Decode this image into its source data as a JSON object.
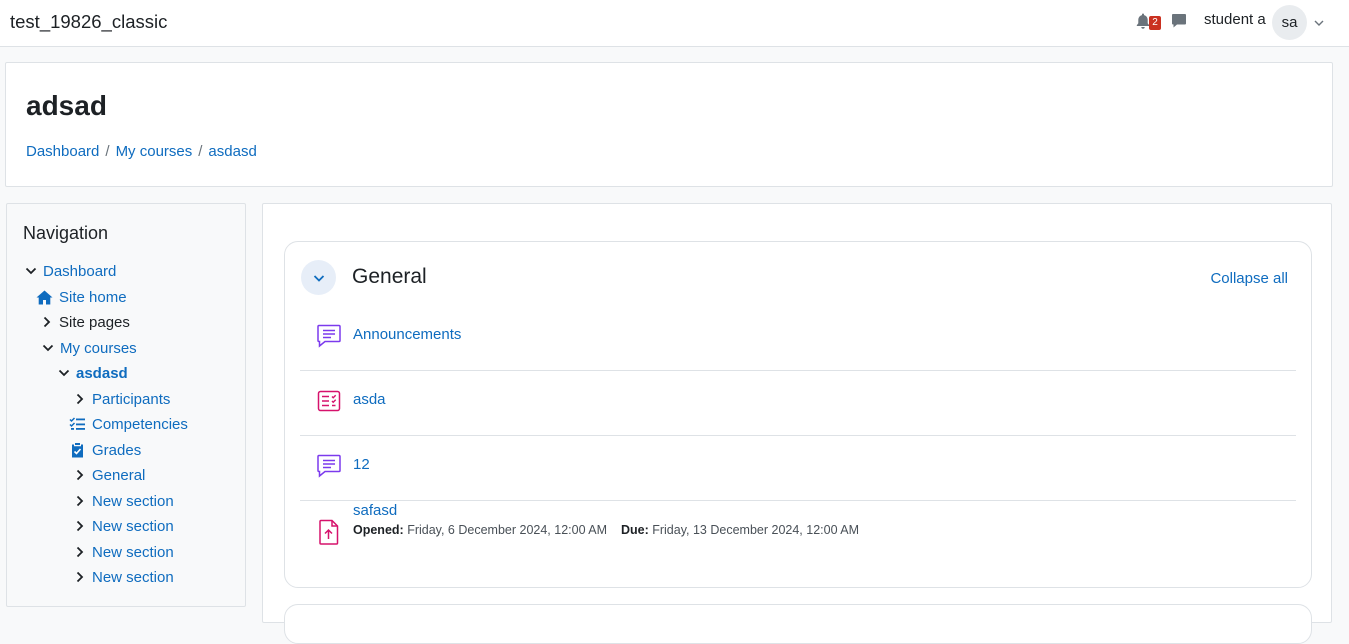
{
  "navbar": {
    "site_name": "test_19826_classic",
    "notifications_count": "2",
    "username": "student a",
    "avatar_initials": "sa"
  },
  "header": {
    "title": "adsad",
    "breadcrumb": [
      "Dashboard",
      "My courses",
      "asdasd"
    ]
  },
  "navigation": {
    "title": "Navigation",
    "items": [
      {
        "label": "Dashboard"
      },
      {
        "label": "Site home"
      },
      {
        "label": "Site pages"
      },
      {
        "label": "My courses"
      },
      {
        "label": "asdasd"
      },
      {
        "label": "Participants"
      },
      {
        "label": "Competencies"
      },
      {
        "label": "Grades"
      },
      {
        "label": "General"
      },
      {
        "label": "New section"
      },
      {
        "label": "New section"
      },
      {
        "label": "New section"
      },
      {
        "label": "New section"
      }
    ]
  },
  "section": {
    "title": "General",
    "collapse_all_label": "Collapse all",
    "activities": [
      {
        "name": "Announcements",
        "icon": "forum-icon"
      },
      {
        "name": "asda",
        "icon": "quiz-icon"
      },
      {
        "name": "12",
        "icon": "forum-icon"
      },
      {
        "name": "safasd",
        "icon": "assignment-upload-icon",
        "opened_label": "Opened:",
        "opened_value": "Friday, 6 December 2024, 12:00 AM",
        "due_label": "Due:",
        "due_value": "Friday, 13 December 2024, 12:00 AM"
      }
    ]
  },
  "colors": {
    "link": "#0f6cbf",
    "forum_icon": "#7c3aed",
    "pink_icon": "#d6126c",
    "badge": "#ca3120"
  }
}
